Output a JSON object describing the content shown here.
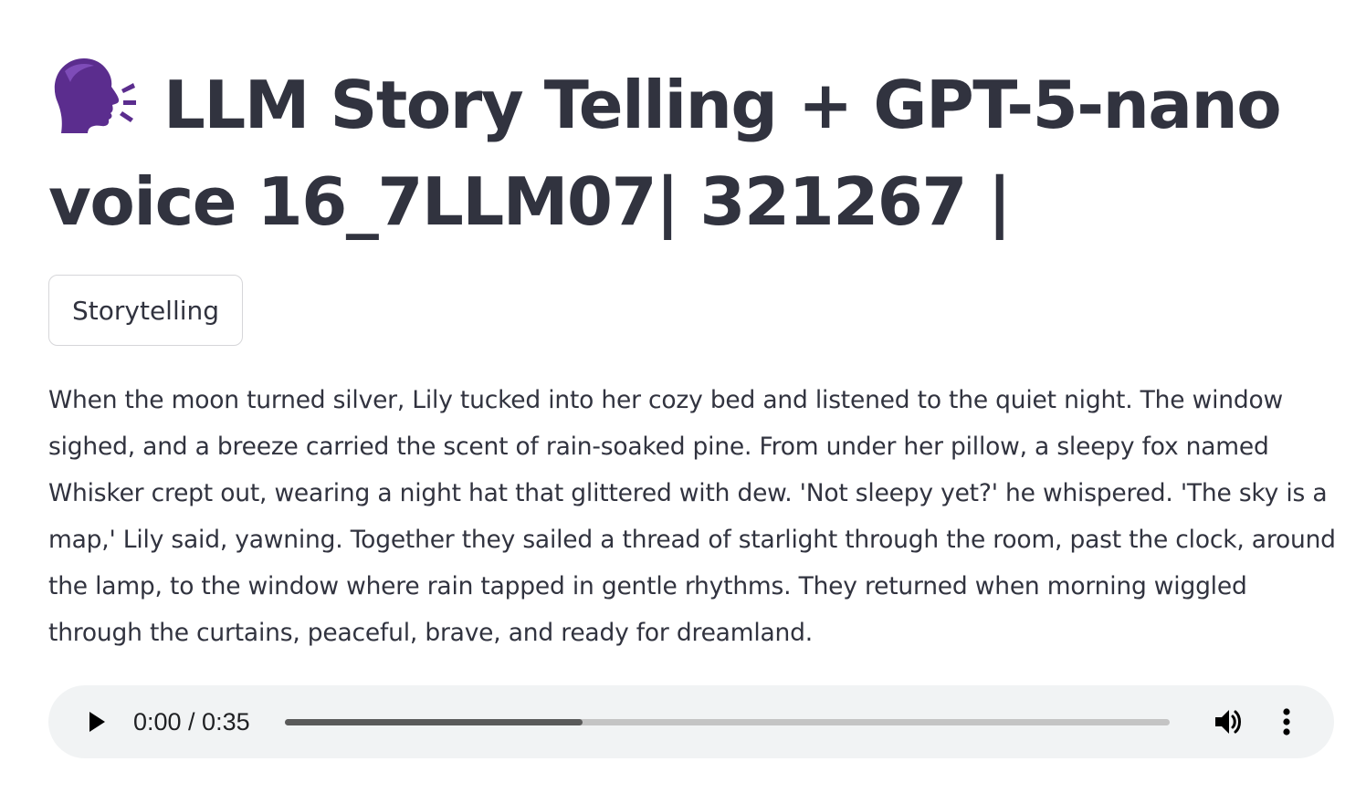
{
  "title": {
    "icon": "speaking-head-icon",
    "text": "LLM Story Telling + GPT-5-nano voice 16_7LLM07| 321267 |"
  },
  "storytelling_button": {
    "label": "Storytelling"
  },
  "story": {
    "text": "When the moon turned silver, Lily tucked into her cozy bed and listened to the quiet night. The window sighed, and a breeze carried the scent of rain-soaked pine. From under her pillow, a sleepy fox named Whisker crept out, wearing a night hat that glittered with dew. 'Not sleepy yet?' he whispered. 'The sky is a map,' Lily said, yawning. Together they sailed a thread of starlight through the room, past the clock, around the lamp, to the window where rain tapped in gentle rhythms. They returned when morning wiggled through the curtains, peaceful, brave, and ready for dreamland."
  },
  "audio_player": {
    "play_icon": "play-icon",
    "time_display": "0:00 / 0:35",
    "progress_fraction": 0.336,
    "volume_icon": "volume-icon",
    "menu_icon": "more-vert-icon"
  },
  "colors": {
    "text": "#31333f",
    "player_bg": "#f1f3f4",
    "button_border": "#d6d6d9",
    "icon_purple": "#5b2d8e"
  }
}
